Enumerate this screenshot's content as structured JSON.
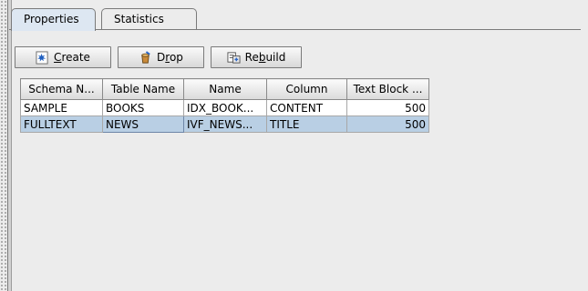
{
  "tabs": [
    {
      "label": "Properties",
      "active": true
    },
    {
      "label": "Statistics",
      "active": false
    }
  ],
  "toolbar": {
    "create_label_mnemonic": "C",
    "create_label_rest": "reate",
    "drop_label_prefix": "D",
    "drop_label_mnemonic": "r",
    "drop_label_rest": "op",
    "rebuild_label_prefix": "Re",
    "rebuild_label_mnemonic": "b",
    "rebuild_label_rest": "uild"
  },
  "icons": {
    "create": "star-burst-icon",
    "drop": "drop-icon",
    "rebuild": "rebuild-icon"
  },
  "colors": {
    "selected_row": "#b9cfe4",
    "active_tab": "#dde7f2",
    "background": "#ececec"
  },
  "table": {
    "headers": [
      "Schema N...",
      "Table Name",
      "Name",
      "Column",
      "Text Block ..."
    ],
    "rows": [
      {
        "schema": "SAMPLE",
        "table": "BOOKS",
        "name": "IDX_BOOK...",
        "column": "CONTENT",
        "text_block": "500",
        "selected": false
      },
      {
        "schema": "FULLTEXT",
        "table": "NEWS",
        "name": "IVF_NEWS...",
        "column": "TITLE",
        "text_block": "500",
        "selected": true
      }
    ]
  }
}
